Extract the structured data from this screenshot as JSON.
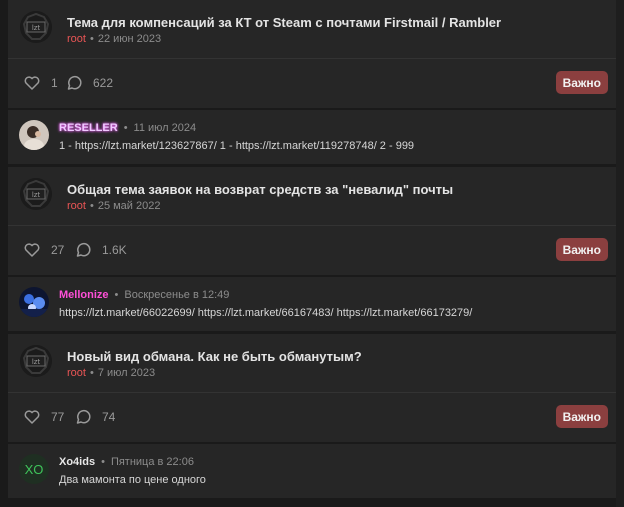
{
  "threads": [
    {
      "title": "Тема для компенсаций за КТ от Steam с почтами Firstmail / Rambler",
      "author": "root",
      "date": "22 июн 2023",
      "likes": "1",
      "comments": "622",
      "badge": "Важно",
      "latest_post": {
        "username": "RESELLER",
        "time": "11 июл 2024",
        "text": "1 - https://lzt.market/123627867/ 1 - https://lzt.market/119278748/ 2 - 999"
      }
    },
    {
      "title": "Общая тема заявок на возврат средств за \"невалид\" почты",
      "author": "root",
      "date": "25 май 2022",
      "likes": "27",
      "comments": "1.6K",
      "badge": "Важно",
      "latest_post": {
        "username": "Mellonize",
        "time": "Воскресенье в 12:49",
        "text": "https://lzt.market/66022699/ https://lzt.market/66167483/ https://lzt.market/66173279/"
      }
    },
    {
      "title": "Новый вид обмана. Как не быть обманутым?",
      "author": "root",
      "date": "7 июл 2023",
      "likes": "77",
      "comments": "74",
      "badge": "Важно",
      "latest_post": {
        "username": "Xo4ids",
        "time": "Пятница в 22:06",
        "text": "Два мамонта по цене одного",
        "avatar_text": "XO"
      }
    }
  ],
  "avatar_logo_text": "lzt",
  "colors": {
    "background": "#1a1a1a",
    "card": "#262626",
    "root_author": "#e95555",
    "badge_bg": "#8b3f3f",
    "reseller": "#f0c8ff",
    "mellonize": "#ff4fd8",
    "xo_avatar": "#3fc45b"
  },
  "icons": [
    "heart-icon",
    "comment-icon",
    "lzt-logo-icon"
  ]
}
